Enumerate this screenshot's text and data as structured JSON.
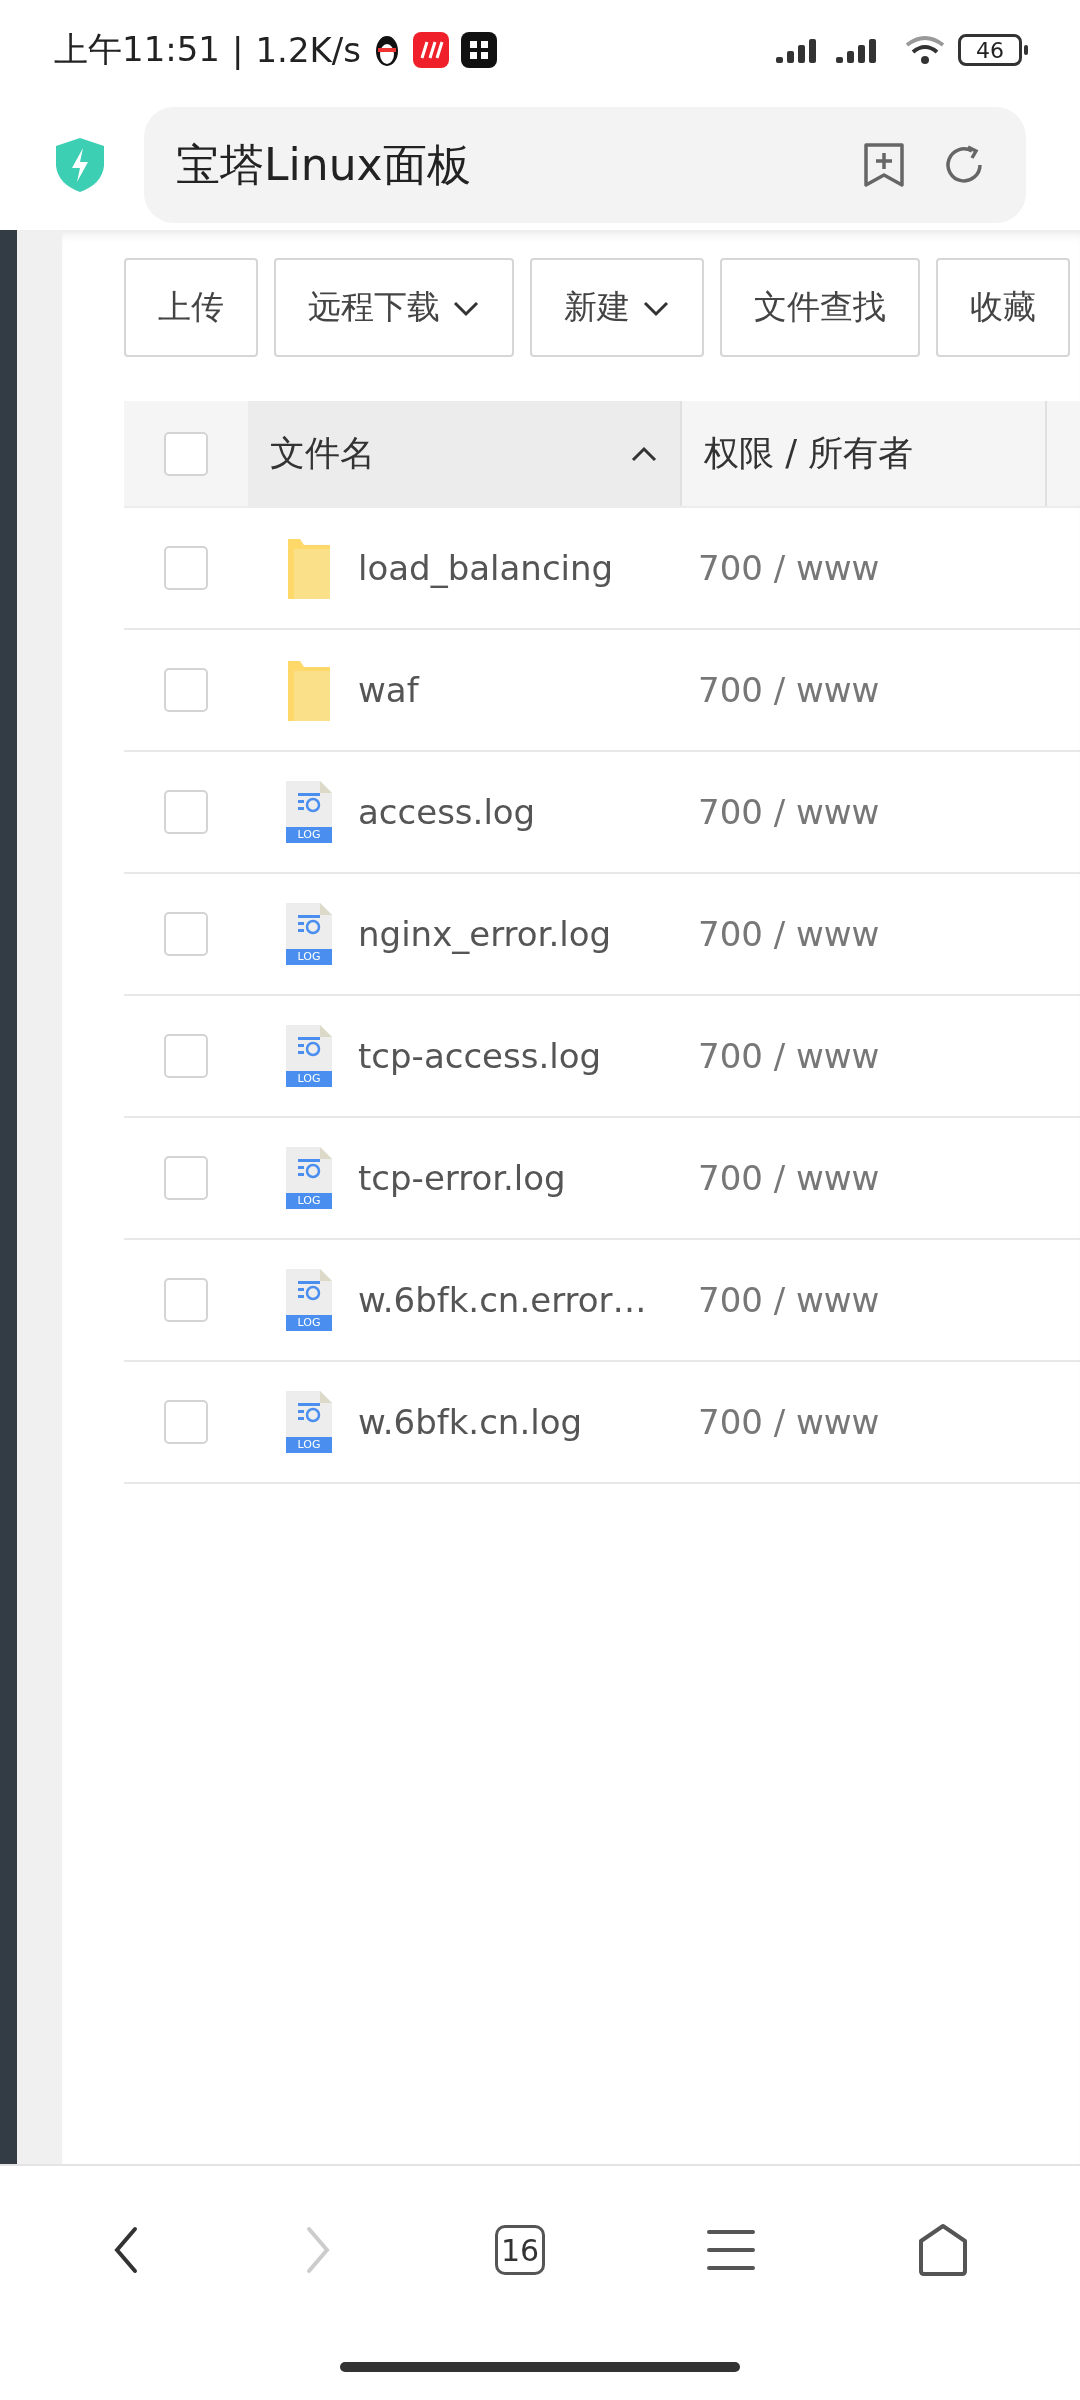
{
  "status_bar": {
    "time": "上午11:51",
    "separator": "|",
    "speed": "1.2K/s",
    "battery": "46"
  },
  "address_bar": {
    "title": "宝塔Linux面板"
  },
  "toolbar": [
    {
      "label": "上传",
      "dropdown": false
    },
    {
      "label": "远程下载",
      "dropdown": true
    },
    {
      "label": "新建",
      "dropdown": true
    },
    {
      "label": "文件查找",
      "dropdown": false
    },
    {
      "label": "收藏",
      "dropdown": false
    }
  ],
  "table": {
    "select_all_checked": false,
    "columns": [
      {
        "label": "文件名",
        "sorted": true
      },
      {
        "label": "权限 / 所有者",
        "sorted": false
      }
    ],
    "rows": [
      {
        "kind": "folder",
        "name": "load_balancing",
        "permission": "700 / www",
        "checked": false
      },
      {
        "kind": "folder",
        "name": "waf",
        "permission": "700 / www",
        "checked": false
      },
      {
        "kind": "log",
        "badge": "LOG",
        "name": "access.log",
        "permission": "700 / www",
        "checked": false
      },
      {
        "kind": "log",
        "badge": "LOG",
        "name": "nginx_error.log",
        "permission": "700 / www",
        "checked": false
      },
      {
        "kind": "log",
        "badge": "LOG",
        "name": "tcp-access.log",
        "permission": "700 / www",
        "checked": false
      },
      {
        "kind": "log",
        "badge": "LOG",
        "name": "tcp-error.log",
        "permission": "700 / www",
        "checked": false
      },
      {
        "kind": "log",
        "badge": "LOG",
        "name": "w.6bfk.cn.error…",
        "permission": "700 / www",
        "checked": false
      },
      {
        "kind": "log",
        "badge": "LOG",
        "name": "w.6bfk.cn.log",
        "permission": "700 / www",
        "checked": false
      }
    ]
  },
  "bottom_nav": {
    "tabs_count": "16"
  }
}
